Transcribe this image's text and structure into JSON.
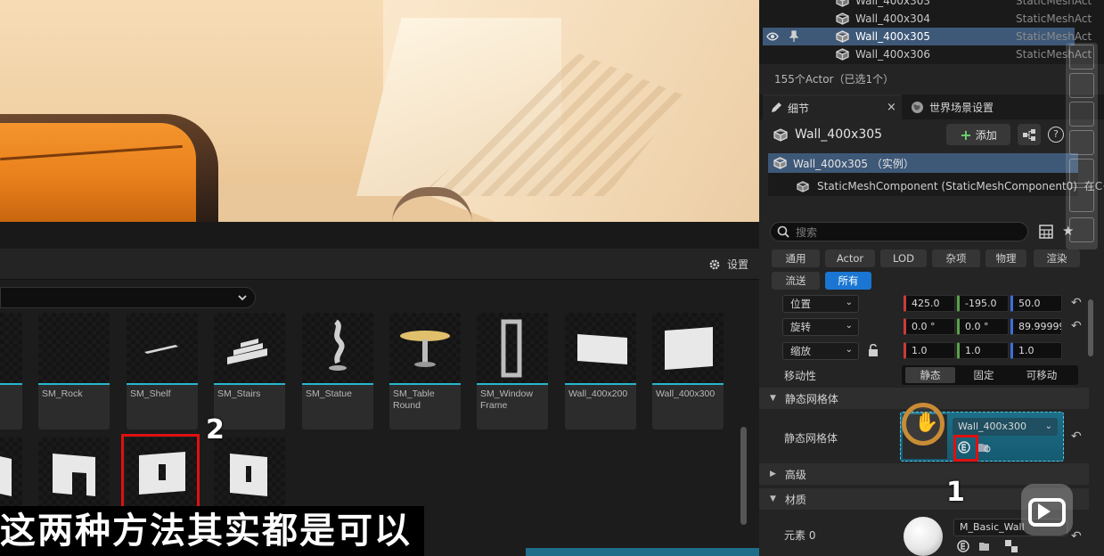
{
  "outliner": {
    "rows": [
      {
        "name": "Wall_400x303",
        "type": "StaticMeshAct"
      },
      {
        "name": "Wall_400x304",
        "type": "StaticMeshAct"
      },
      {
        "name": "Wall_400x305",
        "type": "StaticMeshAct"
      },
      {
        "name": "Wall_400x306",
        "type": "StaticMeshAct"
      }
    ],
    "actor_count": "155个Actor（已选1个）"
  },
  "details": {
    "tab_label": "细节",
    "tab_close": "×",
    "world_tab_label": "世界场景设置",
    "actor_name": "Wall_400x305",
    "add_button": "添加",
    "help": "?",
    "component_root": "Wall_400x305 （实例）",
    "component_child": "StaticMeshComponent (StaticMeshComponent0)",
    "component_child_suffix": "在C+",
    "search_placeholder": "搜索",
    "filters": [
      "通用",
      "Actor",
      "LOD",
      "杂项",
      "物理",
      "渲染",
      "流送",
      "所有"
    ],
    "transform": {
      "location_label": "位置",
      "location": [
        "425.0",
        "-195.0",
        "50.0"
      ],
      "rotation_label": "旋转",
      "rotation": [
        "0.0 °",
        "0.0 °",
        "89.99999"
      ],
      "scale_label": "缩放",
      "scale": [
        "1.0",
        "1.0",
        "1.0"
      ]
    },
    "mobility_label": "移动性",
    "mobility_options": [
      "静态",
      "固定",
      "可移动"
    ],
    "mobility_selected": "静态",
    "static_mesh_section": "静态网格体",
    "static_mesh_label": "静态网格体",
    "static_mesh_value": "Wall_400x300",
    "advanced_section": "高级",
    "materials_section": "材质",
    "element_label": "元素 0",
    "material_value": "M_Basic_Wall"
  },
  "content_browser": {
    "settings_label": "设置",
    "row1": [
      {
        "name": "SM_Rock"
      },
      {
        "name": "SM_Shelf"
      },
      {
        "name": "SM_Stairs"
      },
      {
        "name": "SM_Statue"
      },
      {
        "name": "SM_Table Round"
      },
      {
        "name": "SM_Window Frame"
      },
      {
        "name": "Wall_400x200"
      },
      {
        "name": "Wall_400x300"
      }
    ]
  },
  "annotations": {
    "marker_1": "1",
    "marker_2": "2",
    "subtitle": "这两种方法其实都是可以"
  },
  "colors": {
    "selection": "#3e5878",
    "accent_cyan": "#26b7cc",
    "filter_active": "#1a76d2",
    "annotation_red": "#e01010"
  }
}
